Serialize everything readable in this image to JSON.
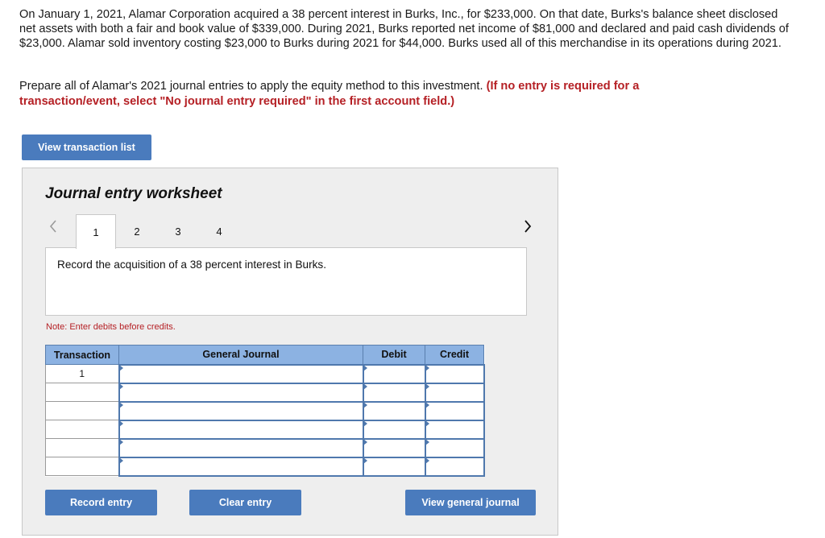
{
  "problem": {
    "text": "On January 1, 2021, Alamar Corporation acquired a 38 percent interest in Burks, Inc., for $233,000. On that date, Burks's balance sheet disclosed net assets with both a fair and book value of $339,000. During 2021, Burks reported net income of $81,000 and declared and paid cash dividends of $23,000. Alamar sold inventory costing $23,000 to Burks during 2021 for $44,000. Burks used all of this merchandise in its operations during 2021.",
    "instruction": "Prepare all of Alamar's 2021 journal entries to apply the equity method to this investment.",
    "instruction_note": "(If no entry is required for a transaction/event, select \"No journal entry required\" in the first account field.)"
  },
  "buttons": {
    "view_transaction_list": "View transaction list",
    "record_entry": "Record entry",
    "clear_entry": "Clear entry",
    "view_general_journal": "View general journal"
  },
  "worksheet": {
    "title": "Journal entry worksheet",
    "tabs": [
      {
        "label": "1",
        "active": true
      },
      {
        "label": "2",
        "active": false
      },
      {
        "label": "3",
        "active": false
      },
      {
        "label": "4",
        "active": false
      }
    ],
    "prev_icon": "chevron-left-icon",
    "next_icon": "chevron-right-icon",
    "description": "Record the acquisition of a 38 percent interest in Burks.",
    "note": "Note: Enter debits before credits."
  },
  "journal_table": {
    "headers": {
      "transaction": "Transaction",
      "general_journal": "General Journal",
      "debit": "Debit",
      "credit": "Credit"
    },
    "rows": [
      {
        "transaction": "1",
        "account": "",
        "debit": "",
        "credit": ""
      },
      {
        "transaction": "",
        "account": "",
        "debit": "",
        "credit": ""
      },
      {
        "transaction": "",
        "account": "",
        "debit": "",
        "credit": ""
      },
      {
        "transaction": "",
        "account": "",
        "debit": "",
        "credit": ""
      },
      {
        "transaction": "",
        "account": "",
        "debit": "",
        "credit": ""
      },
      {
        "transaction": "",
        "account": "",
        "debit": "",
        "credit": ""
      }
    ]
  },
  "colors": {
    "button_blue": "#4a7bbd",
    "header_blue": "#8cb2e2",
    "note_red": "#b52025"
  }
}
